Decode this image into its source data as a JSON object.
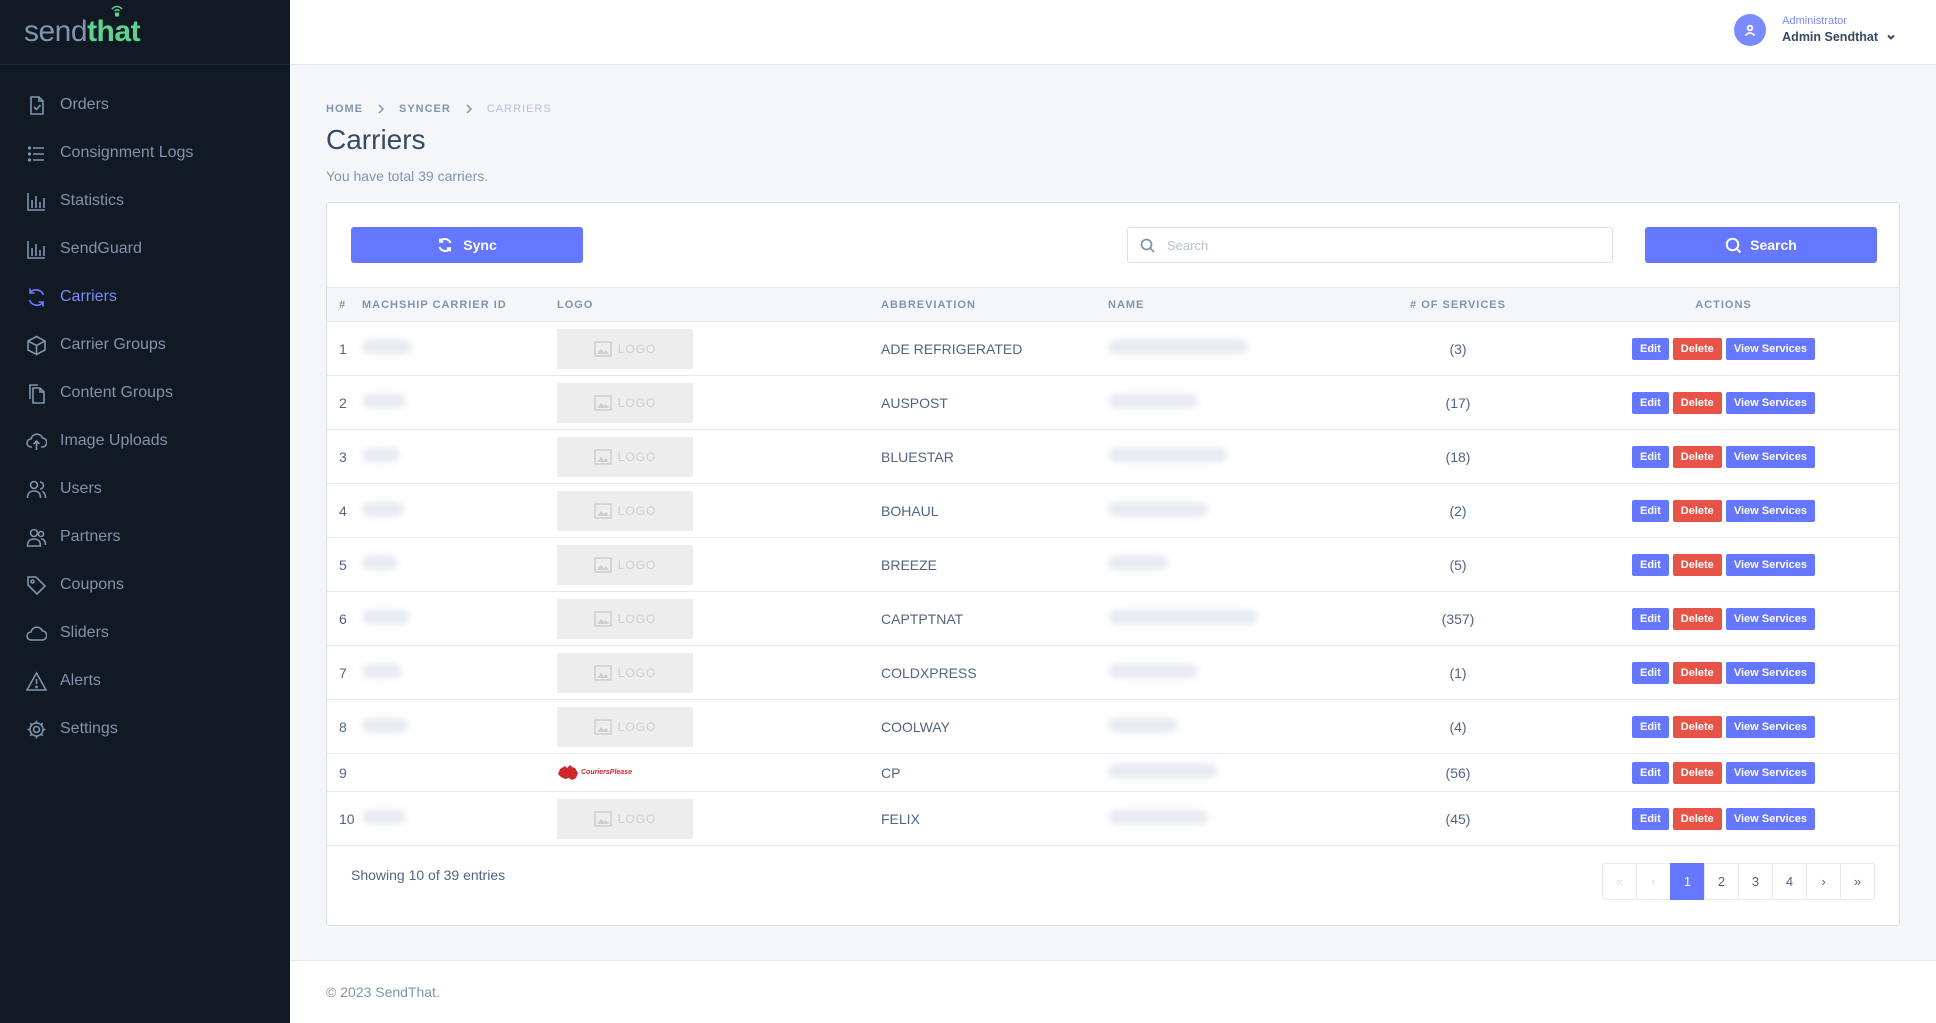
{
  "brand": {
    "part1": "send",
    "part2": "that"
  },
  "sidebar": {
    "items": [
      {
        "label": "Orders",
        "icon": "file-check-icon",
        "active": false
      },
      {
        "label": "Consignment Logs",
        "icon": "list-icon",
        "active": false
      },
      {
        "label": "Statistics",
        "icon": "bar-chart-icon",
        "active": false
      },
      {
        "label": "SendGuard",
        "icon": "bar-chart-icon",
        "active": false
      },
      {
        "label": "Carriers",
        "icon": "sync-icon",
        "active": true
      },
      {
        "label": "Carrier Groups",
        "icon": "box-icon",
        "active": false
      },
      {
        "label": "Content Groups",
        "icon": "files-icon",
        "active": false
      },
      {
        "label": "Image Uploads",
        "icon": "cloud-upload-icon",
        "active": false
      },
      {
        "label": "Users",
        "icon": "users-icon",
        "active": false
      },
      {
        "label": "Partners",
        "icon": "user-group-icon",
        "active": false
      },
      {
        "label": "Coupons",
        "icon": "tag-icon",
        "active": false
      },
      {
        "label": "Sliders",
        "icon": "cloud-icon",
        "active": false
      },
      {
        "label": "Alerts",
        "icon": "alert-icon",
        "active": false
      },
      {
        "label": "Settings",
        "icon": "gear-icon",
        "active": false
      }
    ]
  },
  "header": {
    "user_role": "Administrator",
    "user_name": "Admin Sendthat"
  },
  "breadcrumb": [
    "Home",
    "Syncer",
    "Carriers"
  ],
  "page": {
    "title": "Carriers",
    "subtitle": "You have total 39 carriers."
  },
  "toolbar": {
    "sync_label": "Sync",
    "search_placeholder": "Search",
    "search_value": "",
    "search_label": "Search"
  },
  "table": {
    "columns": [
      "#",
      "Machship Carrier ID",
      "Logo",
      "Abbreviation",
      "Name",
      "# of Services",
      "Actions"
    ],
    "logo_placeholder": "LOGO",
    "cp_logo_text": "CouriersPlease",
    "rows": [
      {
        "num": "1",
        "abbreviation": "ADE REFRIGERATED",
        "services": "(3)",
        "logo": "placeholder"
      },
      {
        "num": "2",
        "abbreviation": "AUSPOST",
        "services": "(17)",
        "logo": "placeholder"
      },
      {
        "num": "3",
        "abbreviation": "BLUESTAR",
        "services": "(18)",
        "logo": "placeholder"
      },
      {
        "num": "4",
        "abbreviation": "BOHAUL",
        "services": "(2)",
        "logo": "placeholder"
      },
      {
        "num": "5",
        "abbreviation": "BREEZE",
        "services": "(5)",
        "logo": "placeholder"
      },
      {
        "num": "6",
        "abbreviation": "CAPTPTNAT",
        "services": "(357)",
        "logo": "placeholder"
      },
      {
        "num": "7",
        "abbreviation": "COLDXPRESS",
        "services": "(1)",
        "logo": "placeholder"
      },
      {
        "num": "8",
        "abbreviation": "COOLWAY",
        "services": "(4)",
        "logo": "placeholder"
      },
      {
        "num": "9",
        "abbreviation": "CP",
        "services": "(56)",
        "logo": "couriersplease"
      },
      {
        "num": "10",
        "abbreviation": "FELIX",
        "services": "(45)",
        "logo": "placeholder"
      }
    ],
    "actions": {
      "edit": "Edit",
      "delete": "Delete",
      "view": "View Services"
    }
  },
  "pagination": {
    "entries_text": "Showing 10 of 39 entries",
    "first": "«",
    "prev": "‹",
    "pages": [
      "1",
      "2",
      "3",
      "4"
    ],
    "current": "1",
    "next": "›",
    "last": "»"
  },
  "footer": {
    "text": "© 2023 SendThat."
  },
  "colors": {
    "primary": "#6576ff",
    "danger": "#e85347",
    "sidebar_bg": "#101924",
    "brand_green": "#5fd38d"
  }
}
